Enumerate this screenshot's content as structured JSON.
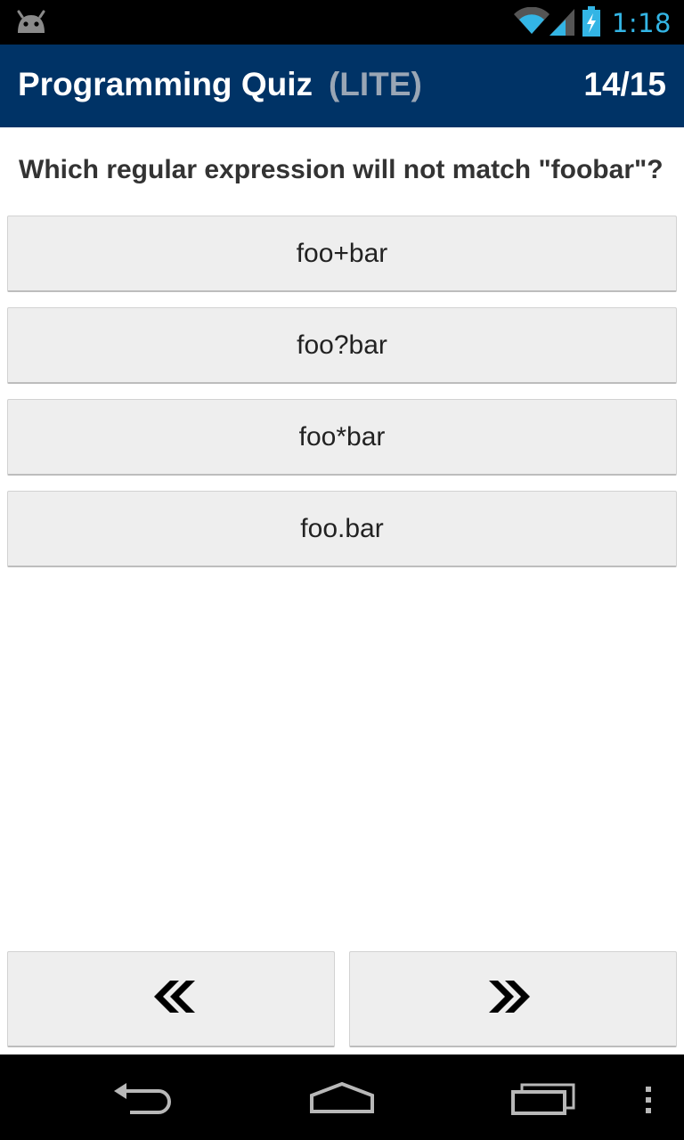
{
  "status_bar": {
    "time": "1:18",
    "icons": [
      "android-debug-icon",
      "wifi-icon",
      "signal-icon",
      "battery-charging-icon"
    ]
  },
  "app_bar": {
    "title": "Programming Quiz",
    "edition": "(LITE)",
    "progress": "14/15"
  },
  "question": {
    "text": "Which regular expression will not match \"foobar\"?"
  },
  "answers": [
    {
      "label": "foo+bar"
    },
    {
      "label": "foo?bar"
    },
    {
      "label": "foo*bar"
    },
    {
      "label": "foo.bar"
    }
  ],
  "navigation": {
    "previous_icon": "double-chevron-left-icon",
    "next_icon": "double-chevron-right-icon"
  },
  "system_nav": {
    "icons": [
      "back-icon",
      "home-icon",
      "recent-apps-icon",
      "overflow-menu-icon"
    ]
  },
  "colors": {
    "app_bar": "#003366",
    "edition_text": "#9aa6b5",
    "status_time": "#33b5e5",
    "button_bg": "#eeeeee"
  }
}
